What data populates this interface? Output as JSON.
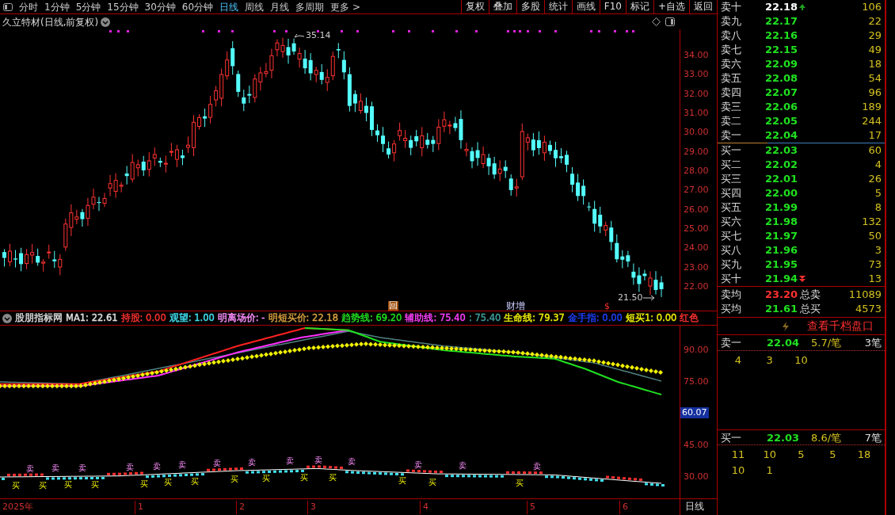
{
  "toolbar": {
    "periods": [
      {
        "label": "分时",
        "selected": false
      },
      {
        "label": "1分钟",
        "selected": false
      },
      {
        "label": "5分钟",
        "selected": false
      },
      {
        "label": "15分钟",
        "selected": false
      },
      {
        "label": "30分钟",
        "selected": false
      },
      {
        "label": "60分钟",
        "selected": false
      },
      {
        "label": "日线",
        "selected": true
      },
      {
        "label": "周线",
        "selected": false
      },
      {
        "label": "月线",
        "selected": false
      },
      {
        "label": "多周期",
        "selected": false
      },
      {
        "label": "更多 >",
        "selected": false
      }
    ],
    "buttons": [
      "复权",
      "叠加",
      "多股",
      "统计",
      "画线",
      "F10",
      "标记",
      "+自选",
      "返回"
    ]
  },
  "main_chart": {
    "title": "久立特材(日线,前复权)",
    "price_ticks": [
      "34.00",
      "33.00",
      "32.00",
      "31.00",
      "30.00",
      "29.00",
      "28.00",
      "27.00",
      "26.00",
      "25.00",
      "24.00",
      "23.00",
      "22.00"
    ],
    "high_label": "35.14",
    "low_label": "21.50",
    "events": [
      {
        "kind": "box",
        "label": "回"
      },
      {
        "kind": "text",
        "label": "财增"
      },
      {
        "kind": "dollar",
        "label": "$"
      }
    ]
  },
  "indicator": {
    "name": "股朋指标网",
    "legend": [
      {
        "label": "MA1: 22.61",
        "color": "#e0e0e0"
      },
      {
        "label": "持股: 0.00",
        "color": "#ff3030"
      },
      {
        "label": "观望: 1.00",
        "color": "#40e0f0"
      },
      {
        "label": "明离场价: -",
        "color": "#ff90ff"
      },
      {
        "label": "明短买价: 22.18",
        "color": "#d8a040"
      },
      {
        "label": "趋势线: 69.20",
        "color": "#20e020"
      },
      {
        "label": "辅助线: 75.40",
        "color": "#ff40ff"
      },
      {
        "label": ": 75.40",
        "color": "#40a0a0"
      },
      {
        "label": "生命线: 79.37",
        "color": "#f0f000"
      },
      {
        "label": "金手指: 0.00",
        "color": "#2040ff"
      },
      {
        "label": "短买1: 0.00",
        "color": "#f0f000"
      },
      {
        "label": "红色",
        "color": "#ff3030"
      }
    ],
    "ticks": [
      "90.00",
      "75.00",
      "45.00",
      "30.00"
    ],
    "current_value": "60.07",
    "signals": [
      {
        "kind": "buy",
        "label": "买"
      },
      {
        "kind": "sell",
        "label": "卖"
      },
      {
        "kind": "buy",
        "label": "买"
      },
      {
        "kind": "sell",
        "label": "卖"
      },
      {
        "kind": "buy",
        "label": "买"
      },
      {
        "kind": "sell",
        "label": "卖"
      },
      {
        "kind": "buy",
        "label": "买"
      },
      {
        "kind": "sell",
        "label": "卖"
      },
      {
        "kind": "buy",
        "label": "买"
      },
      {
        "kind": "sell",
        "label": "卖"
      },
      {
        "kind": "buy",
        "label": "买"
      },
      {
        "kind": "sell",
        "label": "卖"
      },
      {
        "kind": "buy",
        "label": "买"
      },
      {
        "kind": "sell",
        "label": "卖"
      },
      {
        "kind": "buy",
        "label": "买"
      },
      {
        "kind": "sell",
        "label": "卖"
      },
      {
        "kind": "buy",
        "label": "买"
      },
      {
        "kind": "sell",
        "label": "卖"
      },
      {
        "kind": "buy",
        "label": "买"
      },
      {
        "kind": "sell",
        "label": "卖"
      },
      {
        "kind": "buy",
        "label": "买"
      },
      {
        "kind": "sell",
        "label": "卖"
      },
      {
        "kind": "buy",
        "label": "买"
      },
      {
        "kind": "sell",
        "label": "卖"
      },
      {
        "kind": "buy",
        "label": "买"
      },
      {
        "kind": "sell",
        "label": "卖"
      },
      {
        "kind": "buy",
        "label": "买"
      },
      {
        "kind": "sell",
        "label": "卖"
      }
    ]
  },
  "x_axis": {
    "labels": [
      "2025年",
      "1",
      "2",
      "3",
      "4",
      "5",
      "6"
    ],
    "period": "日线"
  },
  "order_book": {
    "asks": [
      {
        "kind": "up",
        "label": "卖十",
        "price": "22.18",
        "volume": "106",
        "color": "#ffffff"
      },
      {
        "kind": "plain",
        "label": "卖九",
        "price": "22.17",
        "volume": "22",
        "color": "#20e020"
      },
      {
        "kind": "plain",
        "label": "卖八",
        "price": "22.16",
        "volume": "29",
        "color": "#20e020"
      },
      {
        "kind": "plain",
        "label": "卖七",
        "price": "22.15",
        "volume": "49",
        "color": "#20e020"
      },
      {
        "kind": "plain",
        "label": "卖六",
        "price": "22.09",
        "volume": "18",
        "color": "#20e020"
      },
      {
        "kind": "plain",
        "label": "卖五",
        "price": "22.08",
        "volume": "54",
        "color": "#20e020"
      },
      {
        "kind": "plain",
        "label": "卖四",
        "price": "22.07",
        "volume": "96",
        "color": "#20e020"
      },
      {
        "kind": "plain",
        "label": "卖三",
        "price": "22.06",
        "volume": "189",
        "color": "#20e020"
      },
      {
        "kind": "plain",
        "label": "卖二",
        "price": "22.05",
        "volume": "244",
        "color": "#20e020"
      },
      {
        "kind": "plain",
        "label": "卖一",
        "price": "22.04",
        "volume": "17",
        "color": "#20e020"
      }
    ],
    "bids": [
      {
        "kind": "plain",
        "label": "买一",
        "price": "22.03",
        "volume": "60",
        "color": "#20e020"
      },
      {
        "kind": "plain",
        "label": "买二",
        "price": "22.02",
        "volume": "4",
        "color": "#20e020"
      },
      {
        "kind": "plain",
        "label": "买三",
        "price": "22.01",
        "volume": "26",
        "color": "#20e020"
      },
      {
        "kind": "plain",
        "label": "买四",
        "price": "22.00",
        "volume": "5",
        "color": "#20e020"
      },
      {
        "kind": "plain",
        "label": "买五",
        "price": "21.99",
        "volume": "8",
        "color": "#20e020"
      },
      {
        "kind": "plain",
        "label": "买六",
        "price": "21.98",
        "volume": "132",
        "color": "#20e020"
      },
      {
        "kind": "plain",
        "label": "买七",
        "price": "21.97",
        "volume": "50",
        "color": "#20e020"
      },
      {
        "kind": "plain",
        "label": "买八",
        "price": "21.96",
        "volume": "3",
        "color": "#20e020"
      },
      {
        "kind": "plain",
        "label": "买九",
        "price": "21.95",
        "volume": "73",
        "color": "#20e020"
      },
      {
        "kind": "down",
        "label": "买十",
        "price": "21.94",
        "volume": "13",
        "color": "#20e020"
      }
    ],
    "summary": [
      {
        "label": "卖均",
        "price": "23.20",
        "color": "#ff3030",
        "total_label": "总卖",
        "total": "11089"
      },
      {
        "label": "买均",
        "price": "21.61",
        "color": "#20e020",
        "total_label": "总买",
        "total": "4573"
      }
    ]
  },
  "level2": {
    "link": "查看千档盘口",
    "queues": [
      {
        "label": "卖一",
        "price": "22.04",
        "average": "5.7/笔",
        "count": "3笔",
        "orders": [
          "4",
          "3",
          "10"
        ]
      },
      {
        "label": "买一",
        "price": "22.03",
        "average": "8.6/笔",
        "count": "7笔",
        "orders": [
          "11",
          "10",
          "5",
          "5",
          "18",
          "10",
          "1"
        ]
      }
    ]
  }
}
